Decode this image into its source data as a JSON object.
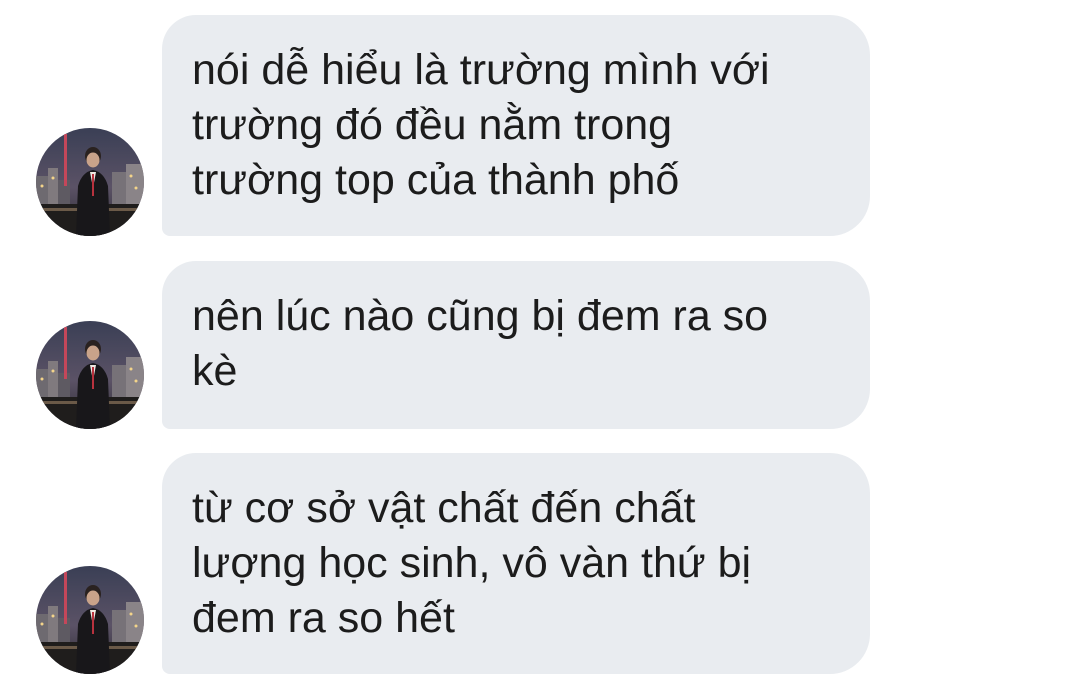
{
  "thread": {
    "messages": [
      {
        "text": "nói dễ hiểu là trường mình với\ntrường đó đều nằm trong\ntrường top của thành phố",
        "avatar": "user-avatar"
      },
      {
        "text": "nên lúc nào cũng bị đem ra so\nkè",
        "avatar": "user-avatar"
      },
      {
        "text": "từ cơ sở vật chất đến chất\nlượng học sinh, vô vàn thứ bị\nđem ra so hết",
        "avatar": "user-avatar"
      }
    ]
  },
  "colors": {
    "bubble": "#e9ecf0",
    "text": "#1c1c1c",
    "background": "#ffffff"
  }
}
